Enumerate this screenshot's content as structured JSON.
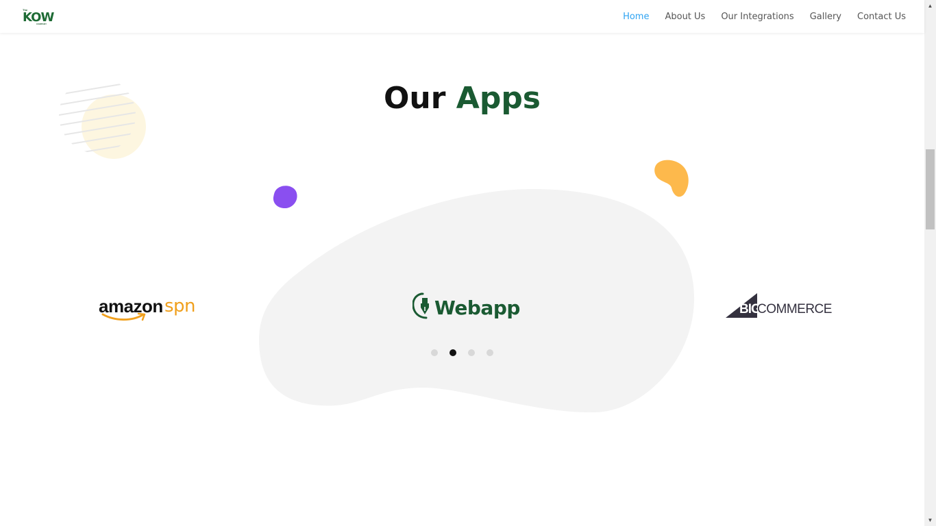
{
  "header": {
    "logo": {
      "top_text": "The",
      "main_text": "KOW",
      "sub_text": "COMPANY"
    },
    "nav": [
      {
        "label": "Home",
        "active": true
      },
      {
        "label": "About Us",
        "active": false
      },
      {
        "label": "Our Integrations",
        "active": false
      },
      {
        "label": "Gallery",
        "active": false
      },
      {
        "label": "Contact Us",
        "active": false
      }
    ]
  },
  "section": {
    "title_plain": "Our",
    "title_accent": "Apps"
  },
  "carousel": {
    "slides": [
      {
        "name": "amazon-spn",
        "word1": "amazon",
        "word2": "spn"
      },
      {
        "name": "webapp",
        "word": "Webapp"
      },
      {
        "name": "bigcommerce",
        "word1": "BIG",
        "word2": "COMMERCE"
      }
    ],
    "page_count": 4,
    "active_page": 2
  },
  "colors": {
    "brand_green": "#1a5a32",
    "nav_active": "#2ea3f2",
    "amazon_orange": "#f0a01e",
    "bigcommerce_dark": "#34313f",
    "blob_purple": "#8a4ff0",
    "blob_orange": "#fdb94c",
    "blob_cream": "#fdf6e0",
    "blob_gray": "#f3f3f3"
  }
}
